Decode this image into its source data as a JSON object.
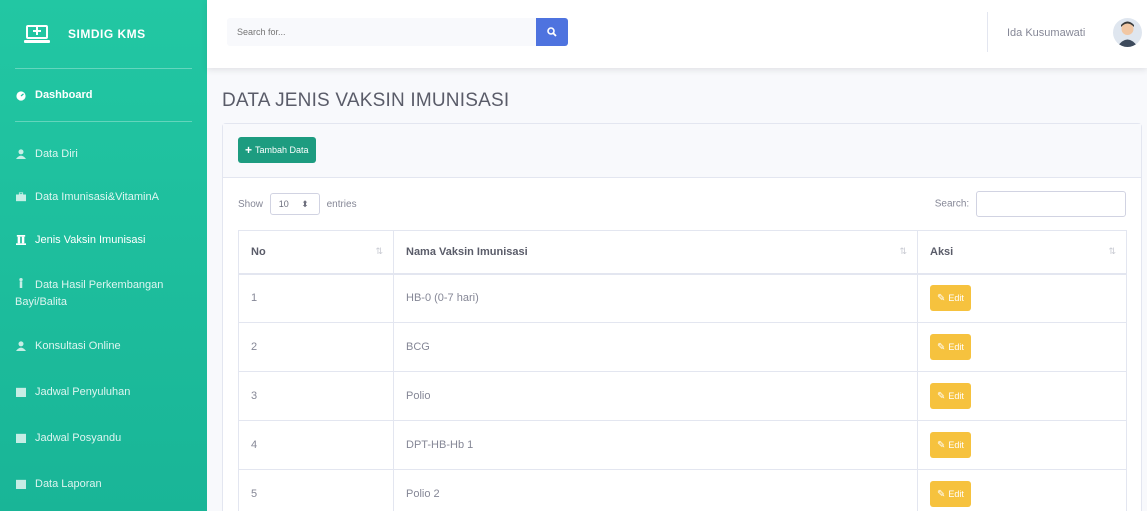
{
  "brand": {
    "name": "SIMDIG KMS",
    "icon": "laptop-plus-icon"
  },
  "sidebar": {
    "dashboard": {
      "label": "Dashboard",
      "icon": "tachometer-icon"
    },
    "items": [
      {
        "label": "Data Diri",
        "icon": "user-icon"
      },
      {
        "label": "Data Imunisasi&VitaminA",
        "icon": "briefcase-icon"
      },
      {
        "label": "Jenis Vaksin Imunisasi",
        "icon": "syringe-icon"
      },
      {
        "label": "Data Hasil Perkembangan Bayi/Balita",
        "icon": "child-icon"
      },
      {
        "label": "Konsultasi Online",
        "icon": "user-icon"
      },
      {
        "label": "Jadwal Penyuluhan",
        "icon": "calendar-icon"
      },
      {
        "label": "Jadwal Posyandu",
        "icon": "calendar-icon"
      },
      {
        "label": "Data Laporan",
        "icon": "report-icon"
      }
    ]
  },
  "topbar": {
    "search_placeholder": "Search for...",
    "user_name": "Ida Kusumawati"
  },
  "page": {
    "title": "DATA JENIS VAKSIN IMUNISASI"
  },
  "card": {
    "add_label": "Tambah Data",
    "show_label": "Show",
    "entries_value": "10",
    "entries_label": "entries",
    "search_label": "Search:"
  },
  "table": {
    "headers": [
      "No",
      "Nama Vaksin Imunisasi",
      "Aksi"
    ],
    "edit_label": "Edit",
    "rows": [
      {
        "no": "1",
        "name": "HB-0 (0-7 hari)"
      },
      {
        "no": "2",
        "name": "BCG"
      },
      {
        "no": "3",
        "name": "Polio"
      },
      {
        "no": "4",
        "name": "DPT-HB-Hb 1"
      },
      {
        "no": "5",
        "name": "Polio 2"
      }
    ]
  },
  "colors": {
    "sidebar": "#1cc3a0",
    "primary": "#4e73df",
    "warning": "#f6c23e"
  }
}
